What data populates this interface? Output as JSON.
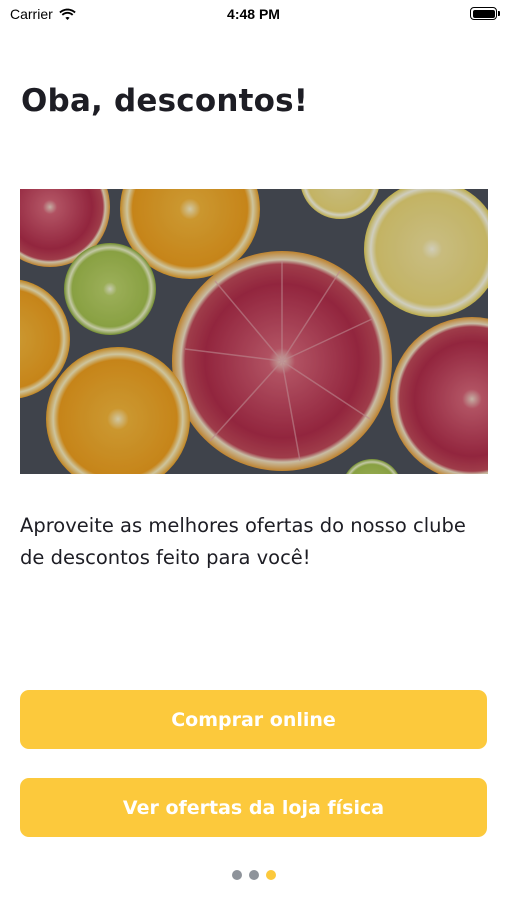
{
  "status_bar": {
    "carrier": "Carrier",
    "time": "4:48 PM"
  },
  "title": "Oba, descontos!",
  "description": "Aproveite as melhores ofertas do nosso clube de descontos feito para você!",
  "buttons": {
    "online": "Comprar online",
    "store": "Ver ofertas da loja física"
  },
  "pagination": {
    "total": 3,
    "active_index": 2
  },
  "colors": {
    "accent": "#fcc93c",
    "text": "#1d1d24",
    "dot_inactive": "#8e939a"
  }
}
